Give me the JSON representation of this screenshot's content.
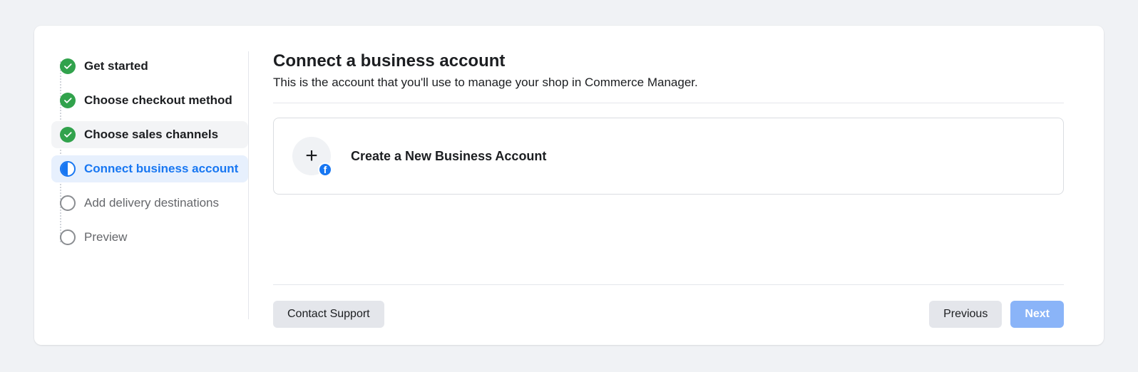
{
  "sidebar": {
    "steps": [
      {
        "label": "Get started",
        "status": "complete"
      },
      {
        "label": "Choose checkout method",
        "status": "complete"
      },
      {
        "label": "Choose sales channels",
        "status": "complete"
      },
      {
        "label": "Connect business account",
        "status": "current"
      },
      {
        "label": "Add delivery destinations",
        "status": "pending"
      },
      {
        "label": "Preview",
        "status": "pending"
      }
    ]
  },
  "main": {
    "title": "Connect a business account",
    "subtitle": "This is the account that you'll use to manage your shop in Commerce Manager.",
    "create_label": "Create a New Business Account"
  },
  "footer": {
    "contact_label": "Contact Support",
    "previous_label": "Previous",
    "next_label": "Next"
  }
}
